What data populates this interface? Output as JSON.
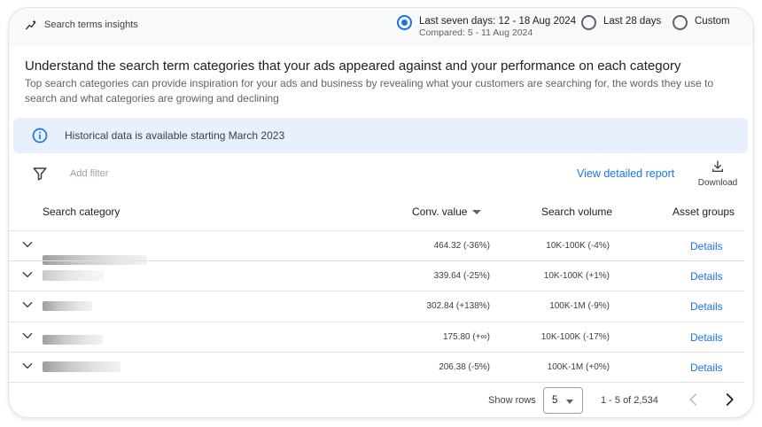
{
  "header": {
    "title": "Search terms insights",
    "date_options": [
      {
        "label": "Last seven days: 12 - 18 Aug 2024",
        "sub": "Compared: 5 - 11 Aug 2024",
        "selected": true
      },
      {
        "label": "Last 28 days",
        "selected": false
      },
      {
        "label": "Custom",
        "selected": false
      }
    ]
  },
  "intro": {
    "heading": "Understand the search term categories that your ads appeared against and your performance on each category",
    "description": "Top search categories can provide inspiration for your ads and business by revealing what your customers are searching for, the words they use to search and what categories are growing and declining"
  },
  "banner": {
    "text": "Historical data is available starting March 2023"
  },
  "toolbar": {
    "add_filter_placeholder": "Add filter",
    "view_report_label": "View detailed report",
    "download_label": "Download"
  },
  "table": {
    "columns": {
      "category": "Search category",
      "conv_value": "Conv. value",
      "search_volume": "Search volume",
      "asset_groups": "Asset groups"
    },
    "rows": [
      {
        "conv_value": "464.32 (-36%)",
        "search_volume": "10K-100K (-4%)",
        "asset_groups": "Details"
      },
      {
        "conv_value": "339.64 (-25%)",
        "search_volume": "10K-100K (+1%)",
        "asset_groups": "Details"
      },
      {
        "conv_value": "302.84 (+138%)",
        "search_volume": "100K-1M (-9%)",
        "asset_groups": "Details"
      },
      {
        "conv_value": "175.80 (+∞)",
        "search_volume": "10K-100K (-17%)",
        "asset_groups": "Details"
      },
      {
        "conv_value": "206.38 (-5%)",
        "search_volume": "100K-1M (+0%)",
        "asset_groups": "Details"
      }
    ]
  },
  "pagination": {
    "show_rows_label": "Show rows",
    "rows_per_page": "5",
    "range_label": "1 - 5 of 2,534"
  },
  "colors": {
    "accent": "#1a73e8",
    "banner_bg": "#e8f0fe"
  },
  "icons": [
    "insights-icon",
    "info-icon",
    "filter-icon",
    "download-icon",
    "chevron-down-icon",
    "chevron-left-icon",
    "chevron-right-icon"
  ]
}
